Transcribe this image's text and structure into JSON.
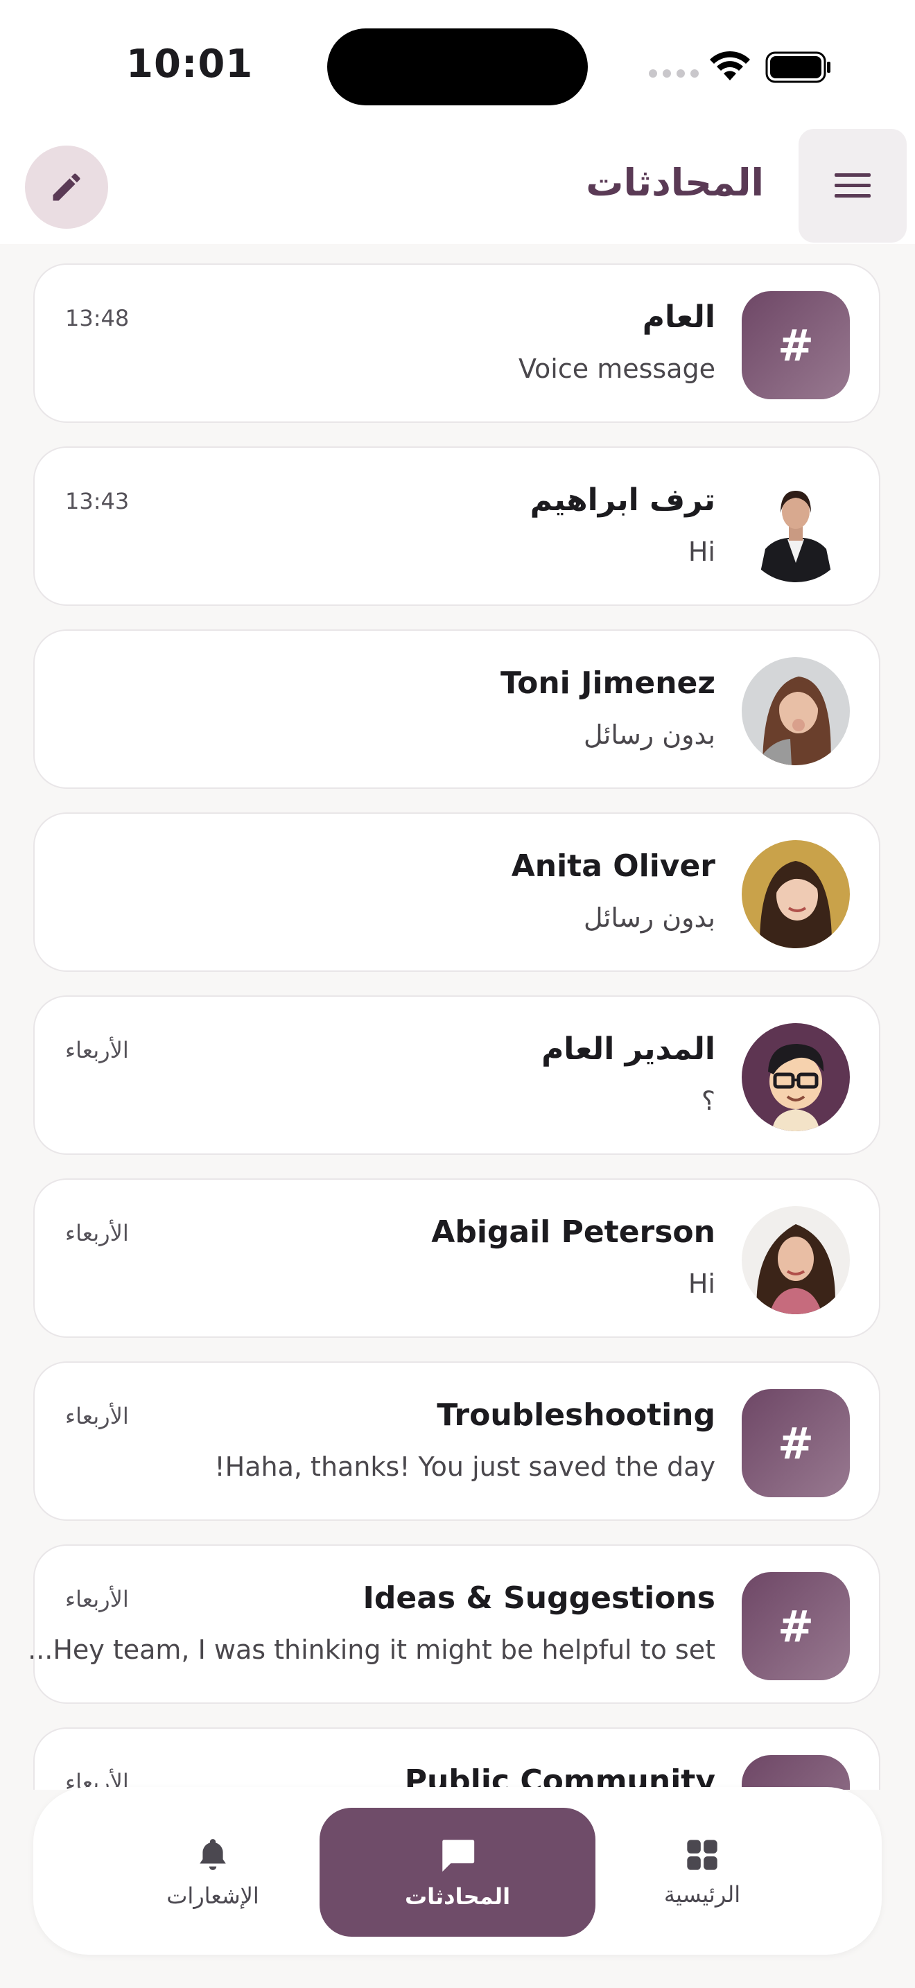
{
  "status_bar": {
    "time": "10:01"
  },
  "app_bar": {
    "title": "المحادثات"
  },
  "conversations": [
    {
      "name": "العام",
      "preview": "Voice message",
      "time": "13:48",
      "avatar": "hash-icon"
    },
    {
      "name": "ترف ابراهيم",
      "preview": "Hi",
      "time": "13:43",
      "avatar": "photo"
    },
    {
      "name": "Toni Jimenez",
      "preview": "بدون رسائل",
      "time": "",
      "avatar": "photo"
    },
    {
      "name": "Anita Oliver",
      "preview": "بدون رسائل",
      "time": "",
      "avatar": "photo"
    },
    {
      "name": "المدير العام",
      "preview": "؟",
      "time": "الأربعاء",
      "avatar": "cartoon"
    },
    {
      "name": "Abigail Peterson",
      "preview": "Hi",
      "time": "الأربعاء",
      "avatar": "photo"
    },
    {
      "name": "Troubleshooting",
      "preview": "!Haha, thanks! You just saved the day",
      "time": "الأربعاء",
      "avatar": "hash-icon"
    },
    {
      "name": "Ideas & Suggestions",
      "preview": "...Hey team, I was thinking it might be helpful to set",
      "time": "الأربعاء",
      "avatar": "hash-icon"
    },
    {
      "name": "Public Community",
      "preview": "",
      "time": "الأربعاء",
      "avatar": "hash-icon"
    }
  ],
  "bottom_nav": {
    "notifications_label": "الإشعارات",
    "chats_label": "المحادثات",
    "home_label": "الرئيسية"
  },
  "colors": {
    "accent": "#6f4c69",
    "title": "#5a3a55",
    "hash_tile_start": "#6e4766",
    "hash_tile_end": "#987990"
  }
}
